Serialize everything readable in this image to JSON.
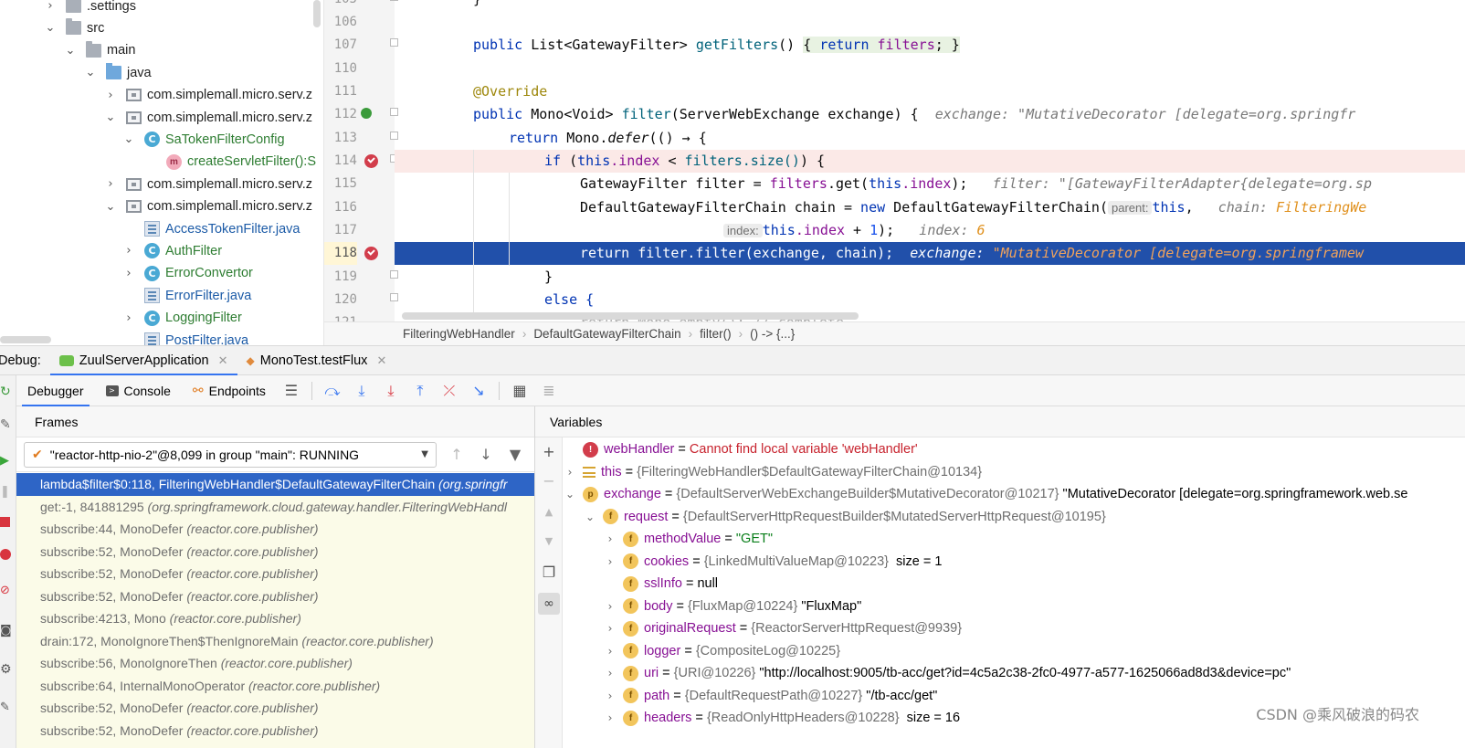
{
  "project_tree": [
    {
      "indent": 0,
      "chev": "›",
      "icon": "folder-gray",
      "label": ".settings",
      "color": ""
    },
    {
      "indent": 0,
      "chev": "⌄",
      "icon": "folder-gray",
      "label": "src",
      "color": ""
    },
    {
      "indent": 1,
      "chev": "⌄",
      "icon": "folder-gray",
      "label": "main",
      "color": ""
    },
    {
      "indent": 2,
      "chev": "⌄",
      "icon": "folder-blue",
      "label": "java",
      "color": ""
    },
    {
      "indent": 3,
      "chev": "›",
      "icon": "pkg",
      "label": "com.simplemall.micro.serv.z",
      "color": ""
    },
    {
      "indent": 3,
      "chev": "⌄",
      "icon": "pkg",
      "label": "com.simplemall.micro.serv.z",
      "color": ""
    },
    {
      "indent": 4,
      "chev": "⌄",
      "icon": "cls",
      "label": "SaTokenFilterConfig",
      "color": "green"
    },
    {
      "indent": 5,
      "chev": "",
      "icon": "meth",
      "label": "createServletFilter():S",
      "color": "green"
    },
    {
      "indent": 3,
      "chev": "›",
      "icon": "pkg",
      "label": "com.simplemall.micro.serv.z",
      "color": ""
    },
    {
      "indent": 3,
      "chev": "⌄",
      "icon": "pkg",
      "label": "com.simplemall.micro.serv.z",
      "color": ""
    },
    {
      "indent": 4,
      "chev": "",
      "icon": "jfile",
      "label": "AccessTokenFilter.java",
      "color": "blue"
    },
    {
      "indent": 4,
      "chev": "›",
      "icon": "cls",
      "label": "AuthFilter",
      "color": "green"
    },
    {
      "indent": 4,
      "chev": "›",
      "icon": "cls",
      "label": "ErrorConvertor",
      "color": "green"
    },
    {
      "indent": 4,
      "chev": "",
      "icon": "jfile",
      "label": "ErrorFilter.java",
      "color": "blue"
    },
    {
      "indent": 4,
      "chev": "›",
      "icon": "cls",
      "label": "LoggingFilter",
      "color": "green"
    },
    {
      "indent": 4,
      "chev": "",
      "icon": "jfile",
      "label": "PostFilter.java",
      "color": "blue"
    }
  ],
  "editor": {
    "line_numbers": [
      "105",
      "106",
      "107",
      "110",
      "111",
      "112",
      "113",
      "114",
      "115",
      "116",
      "117",
      "118",
      "119",
      "120",
      "121"
    ],
    "code": {
      "l105": "}",
      "l107_public": "public ",
      "l107_type": "List<GatewayFilter> ",
      "l107_fn": "getFilters",
      "l107_paren": "() ",
      "l107_body_open": "{ ",
      "l107_return": "return ",
      "l107_filters": "filters",
      "l107_body_close": "; }",
      "l111": "@Override",
      "l112_public": "public ",
      "l112_type": "Mono<Void> ",
      "l112_fn": "filter",
      "l112_params": "(ServerWebExchange exchange) {",
      "l112_inline": "exchange: \"MutativeDecorator [delegate=org.springfr",
      "l113_return": "return ",
      "l113_mono": "Mono.",
      "l113_defer": "defer",
      "l113_rest": "(() → {",
      "l114_if": "if ",
      "l114_open": "(",
      "l114_this": "this",
      "l114_index": ".index",
      "l114_lt": " < ",
      "l114_filters": "filters.size()",
      "l114_close": ") {",
      "l115_decl": "GatewayFilter filter = ",
      "l115_filters": "filters",
      "l115_get": ".get(",
      "l115_this": "this",
      "l115_index": ".index",
      "l115_end": ");",
      "l115_inline": "filter: \"[GatewayFilterAdapter{delegate=org.sp",
      "l116_decl": "DefaultGatewayFilterChain chain = ",
      "l116_new": "new ",
      "l116_ctor": "DefaultGatewayFilterChain(",
      "l116_hint": "parent:",
      "l116_this": "this",
      "l116_comma": ",",
      "l116_inline_label": "chain: ",
      "l116_inline_val": "FilteringWe",
      "l117_hint": "index:",
      "l117_this": "this",
      "l117_index": ".index",
      "l117_plus": " + ",
      "l117_one": "1",
      "l117_end": ");",
      "l117_inline_label": "index: ",
      "l117_inline_val": "6",
      "l118_return": "return ",
      "l118_rest": "filter.filter(exchange, chain);",
      "l118_inline_label": "exchange: ",
      "l118_inline_val": "\"MutativeDecorator [delegate=org.springframew",
      "l119": "}",
      "l120": "else {",
      "l121": "return Mono.empty(); // complete"
    }
  },
  "breadcrumb": [
    "FilteringWebHandler",
    "DefaultGatewayFilterChain",
    "filter()",
    "() -> {...}"
  ],
  "debug_tabs": {
    "label": "Debug:",
    "tabs": [
      {
        "label": "ZuulServerApplication"
      },
      {
        "label": "MonoTest.testFlux"
      }
    ]
  },
  "debugger_toolbar": {
    "tabs": [
      "Debugger",
      "Console",
      "Endpoints"
    ]
  },
  "frames": {
    "title": "Frames",
    "thread": "\"reactor-http-nio-2\"@8,099 in group \"main\": RUNNING",
    "items": [
      {
        "name": "lambda$filter$0:118, FilteringWebHandler$DefaultGatewayFilterChain",
        "pkg": "(org.springfr"
      },
      {
        "name": "get:-1, 841881295",
        "pkg": "(org.springframework.cloud.gateway.handler.FilteringWebHandl"
      },
      {
        "name": "subscribe:44, MonoDefer",
        "pkg": "(reactor.core.publisher)"
      },
      {
        "name": "subscribe:52, MonoDefer",
        "pkg": "(reactor.core.publisher)"
      },
      {
        "name": "subscribe:52, MonoDefer",
        "pkg": "(reactor.core.publisher)"
      },
      {
        "name": "subscribe:52, MonoDefer",
        "pkg": "(reactor.core.publisher)"
      },
      {
        "name": "subscribe:4213, Mono",
        "pkg": "(reactor.core.publisher)"
      },
      {
        "name": "drain:172, MonoIgnoreThen$ThenIgnoreMain",
        "pkg": "(reactor.core.publisher)"
      },
      {
        "name": "subscribe:56, MonoIgnoreThen",
        "pkg": "(reactor.core.publisher)"
      },
      {
        "name": "subscribe:64, InternalMonoOperator",
        "pkg": "(reactor.core.publisher)"
      },
      {
        "name": "subscribe:52, MonoDefer",
        "pkg": "(reactor.core.publisher)"
      },
      {
        "name": "subscribe:52, MonoDefer",
        "pkg": "(reactor.core.publisher)"
      }
    ]
  },
  "variables": {
    "title": "Variables",
    "items": [
      {
        "indent": 0,
        "chev": "",
        "icon": "err",
        "icon_text": "!",
        "name": "webHandler",
        "eq": " = ",
        "type": "",
        "value": "Cannot find local variable 'webHandler'",
        "vclass": "vred"
      },
      {
        "indent": 0,
        "chev": "›",
        "icon": "lines",
        "icon_text": "",
        "name": "this",
        "eq": " = ",
        "type": "{FilteringWebHandler$DefaultGatewayFilterChain@10134}",
        "value": "",
        "vclass": "vplain"
      },
      {
        "indent": 0,
        "chev": "⌄",
        "icon": "p",
        "icon_text": "p",
        "name": "exchange",
        "eq": " = ",
        "type": "{DefaultServerWebExchangeBuilder$MutativeDecorator@10217}",
        "value": " \"MutativeDecorator [delegate=org.springframework.web.se",
        "vclass": "vplain"
      },
      {
        "indent": 1,
        "chev": "⌄",
        "icon": "f",
        "icon_text": "f",
        "name": "request",
        "eq": " = ",
        "type": "{DefaultServerHttpRequestBuilder$MutatedServerHttpRequest@10195}",
        "value": "",
        "vclass": "vplain"
      },
      {
        "indent": 2,
        "chev": "›",
        "icon": "f",
        "icon_text": "f",
        "name": "methodValue",
        "eq": " = ",
        "type": "",
        "value": "\"GET\"",
        "vclass": "vstr"
      },
      {
        "indent": 2,
        "chev": "›",
        "icon": "f",
        "icon_text": "f",
        "name": "cookies",
        "eq": " = ",
        "type": "{LinkedMultiValueMap@10223}",
        "value": "  size = 1",
        "vclass": "vplain"
      },
      {
        "indent": 2,
        "chev": "",
        "icon": "f",
        "icon_text": "f",
        "name": "sslInfo",
        "eq": " = ",
        "type": "",
        "value": "null",
        "vclass": "vplain"
      },
      {
        "indent": 2,
        "chev": "›",
        "icon": "f",
        "icon_text": "f",
        "name": "body",
        "eq": " = ",
        "type": "{FluxMap@10224}",
        "value": " \"FluxMap\"",
        "vclass": "vplain"
      },
      {
        "indent": 2,
        "chev": "›",
        "icon": "f",
        "icon_text": "f",
        "name": "originalRequest",
        "eq": " = ",
        "type": "{ReactorServerHttpRequest@9939}",
        "value": "",
        "vclass": "vplain"
      },
      {
        "indent": 2,
        "chev": "›",
        "icon": "f",
        "icon_text": "f",
        "name": "logger",
        "eq": " = ",
        "type": "{CompositeLog@10225}",
        "value": "",
        "vclass": "vplain"
      },
      {
        "indent": 2,
        "chev": "›",
        "icon": "f",
        "icon_text": "f",
        "name": "uri",
        "eq": " = ",
        "type": "{URI@10226}",
        "value": " \"http://localhost:9005/tb-acc/get?id=4c5a2c38-2fc0-4977-a577-1625066ad8d3&device=pc\"",
        "vclass": "vplain"
      },
      {
        "indent": 2,
        "chev": "›",
        "icon": "f",
        "icon_text": "f",
        "name": "path",
        "eq": " = ",
        "type": "{DefaultRequestPath@10227}",
        "value": " \"/tb-acc/get\"",
        "vclass": "vplain"
      },
      {
        "indent": 2,
        "chev": "›",
        "icon": "f",
        "icon_text": "f",
        "name": "headers",
        "eq": " = ",
        "type": "{ReadOnlyHttpHeaders@10228}",
        "value": "  size = 16",
        "vclass": "vplain"
      }
    ]
  },
  "watermark": "CSDN @乘风破浪的码农"
}
